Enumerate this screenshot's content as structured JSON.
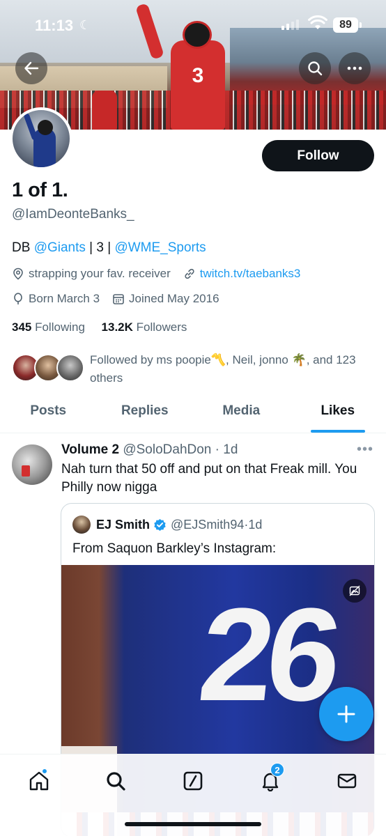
{
  "status_bar": {
    "time": "11:13",
    "battery": "89"
  },
  "profile": {
    "display_name": "1 of 1.",
    "handle": "@IamDeonteBanks_",
    "follow_label": "Follow",
    "bio": {
      "prefix": "DB ",
      "team_link": "@Giants",
      "middle": " | 3 | ",
      "agency_link": "@WME_Sports"
    },
    "location": "strapping your fav. receiver",
    "website": "twitch.tv/taebanks3",
    "birthday": "Born March 3",
    "joined": "Joined May 2016",
    "following_count": "345",
    "following_label": " Following",
    "followers_count": "13.2K",
    "followers_label": " Followers",
    "followed_by": "Followed by ms poopie〽️, Neil, jonno 🌴, and 123 others"
  },
  "tabs": [
    {
      "label": "Posts",
      "active": false
    },
    {
      "label": "Replies",
      "active": false
    },
    {
      "label": "Media",
      "active": false
    },
    {
      "label": "Likes",
      "active": true
    }
  ],
  "tweet": {
    "author_name": "Volume 2",
    "author_handle": "@SoloDahDon",
    "time": "1d",
    "text": "Nah turn that 50 off and put on that Freak mill. You Philly now nigga",
    "quote": {
      "author_name": "EJ Smith",
      "author_handle": "@EJSmith94",
      "time": "1d",
      "text": "From Saquon Barkley’s Instagram:",
      "jersey_number": "26"
    }
  },
  "bottom_nav": {
    "notifications_badge": "2"
  },
  "colors": {
    "accent": "#1d9bf0",
    "text": "#0f1419",
    "secondary": "#536471"
  }
}
